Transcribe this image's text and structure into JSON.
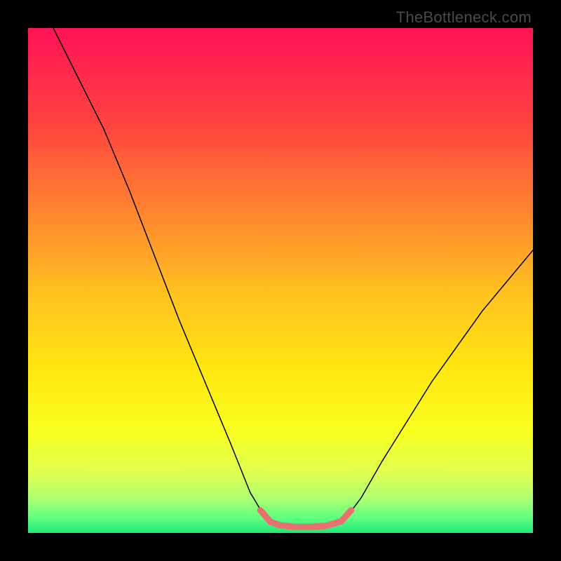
{
  "watermark": "TheBottleneck.com",
  "chart_data": {
    "type": "line",
    "title": "",
    "xlabel": "",
    "ylabel": "",
    "x_range": [
      0,
      100
    ],
    "y_range": [
      0,
      100
    ],
    "series": [
      {
        "name": "curve",
        "color": "#000000",
        "stroke_width": 1.5,
        "points": [
          {
            "x": 5,
            "y": 100
          },
          {
            "x": 10,
            "y": 90
          },
          {
            "x": 15,
            "y": 80
          },
          {
            "x": 20,
            "y": 68
          },
          {
            "x": 25,
            "y": 55
          },
          {
            "x": 30,
            "y": 42
          },
          {
            "x": 35,
            "y": 30
          },
          {
            "x": 40,
            "y": 18
          },
          {
            "x": 44,
            "y": 8
          },
          {
            "x": 47,
            "y": 3
          },
          {
            "x": 50,
            "y": 1.5
          },
          {
            "x": 55,
            "y": 1.2
          },
          {
            "x": 60,
            "y": 1.5
          },
          {
            "x": 63,
            "y": 3
          },
          {
            "x": 66,
            "y": 7
          },
          {
            "x": 70,
            "y": 14
          },
          {
            "x": 75,
            "y": 22
          },
          {
            "x": 80,
            "y": 30
          },
          {
            "x": 85,
            "y": 37
          },
          {
            "x": 90,
            "y": 44
          },
          {
            "x": 95,
            "y": 50
          },
          {
            "x": 100,
            "y": 56
          }
        ]
      },
      {
        "name": "optimal-range-highlight",
        "color": "#e87070",
        "stroke_width": 9,
        "points": [
          {
            "x": 46,
            "y": 4.5
          },
          {
            "x": 48,
            "y": 2.2
          },
          {
            "x": 50,
            "y": 1.5
          },
          {
            "x": 53,
            "y": 1.2
          },
          {
            "x": 56,
            "y": 1.2
          },
          {
            "x": 59,
            "y": 1.4
          },
          {
            "x": 62,
            "y": 2.3
          },
          {
            "x": 64,
            "y": 4.5
          }
        ]
      }
    ],
    "background_gradient": {
      "type": "vertical",
      "stops": [
        {
          "offset": 0,
          "color": "#ff1456"
        },
        {
          "offset": 0.18,
          "color": "#ff4040"
        },
        {
          "offset": 0.35,
          "color": "#ff8030"
        },
        {
          "offset": 0.52,
          "color": "#ffc020"
        },
        {
          "offset": 0.68,
          "color": "#ffe810"
        },
        {
          "offset": 0.8,
          "color": "#f8ff20"
        },
        {
          "offset": 0.88,
          "color": "#e0ff50"
        },
        {
          "offset": 0.93,
          "color": "#b0ff70"
        },
        {
          "offset": 0.97,
          "color": "#60ff80"
        },
        {
          "offset": 1.0,
          "color": "#20e878"
        }
      ]
    }
  }
}
